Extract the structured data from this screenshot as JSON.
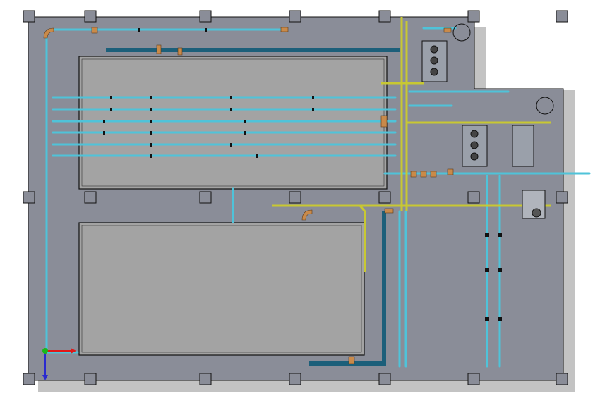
{
  "colors": {
    "background_outer": "#ffffff",
    "drop_shadow": "#b5b5b5",
    "floor": "#8a8d98",
    "tank": "#a3a3a3",
    "pipe_water": "#4fc3d9",
    "pipe_dark": "#1c5f7a",
    "pipe_yellow": "#c8c832",
    "valve_copper": "#c98a4a",
    "outline": "#111111"
  },
  "triad": {
    "x_axis_color": "#e01818",
    "y_axis_color": "#2a2ad0",
    "z_axis_color": "#18b818"
  },
  "icons": [
    "coordinate-triad-icon",
    "pump-icon",
    "valve-icon",
    "pressure-gauge-icon"
  ]
}
